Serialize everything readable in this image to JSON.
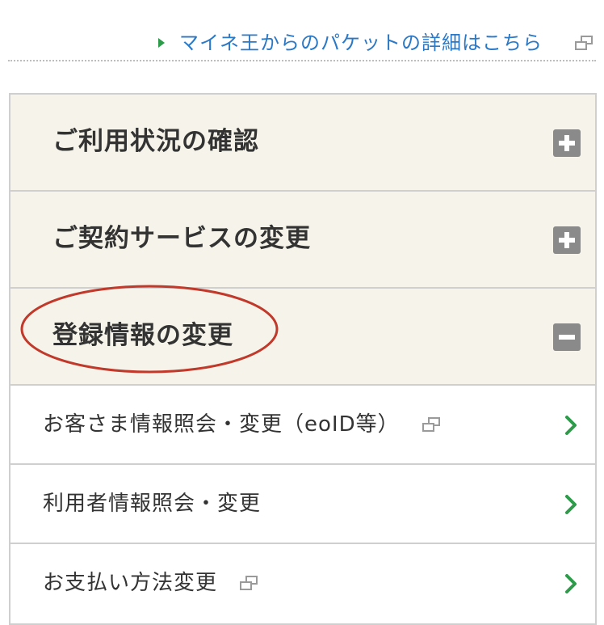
{
  "top_link": {
    "label": "マイネ王からのパケットの詳細はこちら",
    "icon": "external-window-icon",
    "color": "#2a78c6",
    "marker_color": "#2e9b4a"
  },
  "accordion": {
    "sections": [
      {
        "title": "ご利用状況の確認",
        "state": "collapsed",
        "toggle_icon": "plus-icon"
      },
      {
        "title": "ご契約サービスの変更",
        "state": "collapsed",
        "toggle_icon": "plus-icon"
      },
      {
        "title": "登録情報の変更",
        "state": "expanded",
        "toggle_icon": "minus-icon"
      }
    ],
    "items": [
      {
        "label": "お客さま情報照会・変更（eoID等）",
        "external": true,
        "arrow_icon": "chevron-right-icon"
      },
      {
        "label": "利用者情報照会・変更",
        "external": false,
        "arrow_icon": "chevron-right-icon"
      },
      {
        "label": "お支払い方法変更",
        "external": true,
        "arrow_icon": "chevron-right-icon"
      }
    ]
  },
  "annotation": {
    "shape": "ellipse",
    "color": "#c0392b",
    "target": "登録情報の変更"
  },
  "colors": {
    "header_bg": "#f6f4ea",
    "border": "#cfcfcf",
    "toggle_bg": "#8a8a8a",
    "chevron": "#2e9b4a"
  }
}
